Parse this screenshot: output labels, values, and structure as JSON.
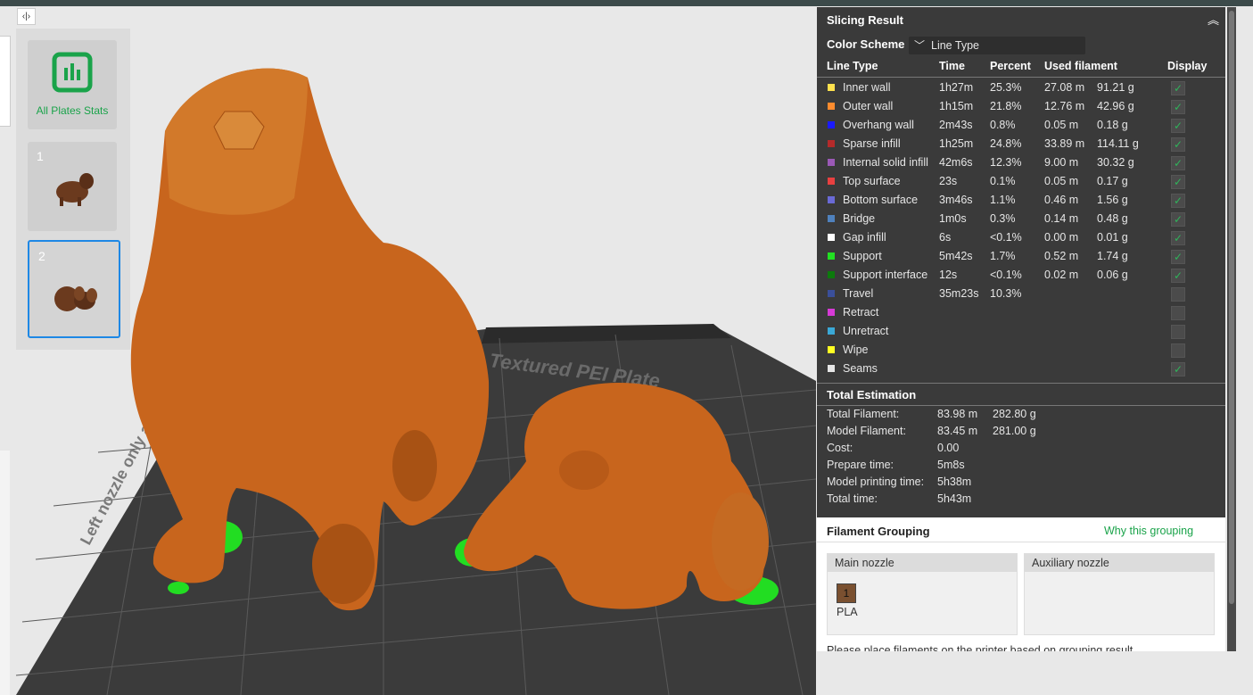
{
  "colors": {
    "accent_green": "#1aa34a",
    "panel_bg": "#3a3a3a",
    "filament_brown": "#7a5030",
    "model_orange": "#c8651d"
  },
  "sidebar": {
    "collapse_icon": "split-view-icon",
    "stats_label": "All Plates Stats",
    "plates": [
      {
        "number": "1"
      },
      {
        "number": "2",
        "selected": true
      }
    ]
  },
  "viewport": {
    "bed_label": "Textured PEI Plate",
    "bed_side_label": "Left nozzle only a"
  },
  "slicing": {
    "title": "Slicing Result",
    "color_scheme_label": "Color Scheme",
    "color_scheme_value": "Line Type",
    "columns": {
      "type": "Line Type",
      "time": "Time",
      "percent": "Percent",
      "filament": "Used filament",
      "display": "Display"
    },
    "rows": [
      {
        "name": "Inner wall",
        "color": "#ffe14d",
        "time": "1h27m",
        "percent": "25.3%",
        "meters": "27.08 m",
        "grams": "91.21 g",
        "display": true
      },
      {
        "name": "Outer wall",
        "color": "#ff8c2e",
        "time": "1h15m",
        "percent": "21.8%",
        "meters": "12.76 m",
        "grams": "42.96 g",
        "display": true
      },
      {
        "name": "Overhang wall",
        "color": "#1a1aff",
        "time": "2m43s",
        "percent": "0.8%",
        "meters": "0.05 m",
        "grams": "0.18 g",
        "display": true
      },
      {
        "name": "Sparse infill",
        "color": "#b52a2a",
        "time": "1h25m",
        "percent": "24.8%",
        "meters": "33.89 m",
        "grams": "114.11 g",
        "display": true
      },
      {
        "name": "Internal solid infill",
        "color": "#9b59b6",
        "time": "42m6s",
        "percent": "12.3%",
        "meters": "9.00 m",
        "grams": "30.32 g",
        "display": true
      },
      {
        "name": "Top surface",
        "color": "#e84040",
        "time": "23s",
        "percent": "0.1%",
        "meters": "0.05 m",
        "grams": "0.17 g",
        "display": true
      },
      {
        "name": "Bottom surface",
        "color": "#6a6ad6",
        "time": "3m46s",
        "percent": "1.1%",
        "meters": "0.46 m",
        "grams": "1.56 g",
        "display": true
      },
      {
        "name": "Bridge",
        "color": "#4f81bd",
        "time": "1m0s",
        "percent": "0.3%",
        "meters": "0.14 m",
        "grams": "0.48 g",
        "display": true
      },
      {
        "name": "Gap infill",
        "color": "#ffffff",
        "time": "6s",
        "percent": "<0.1%",
        "meters": "0.00 m",
        "grams": "0.01 g",
        "display": true
      },
      {
        "name": "Support",
        "color": "#22e022",
        "time": "5m42s",
        "percent": "1.7%",
        "meters": "0.52 m",
        "grams": "1.74 g",
        "display": true
      },
      {
        "name": "Support interface",
        "color": "#0c7a0c",
        "time": "12s",
        "percent": "<0.1%",
        "meters": "0.02 m",
        "grams": "0.06 g",
        "display": true
      },
      {
        "name": "Travel",
        "color": "#3a4f9a",
        "time": "35m23s",
        "percent": "10.3%",
        "meters": "",
        "grams": "",
        "display": false
      },
      {
        "name": "Retract",
        "color": "#d63ad6",
        "time": "",
        "percent": "",
        "meters": "",
        "grams": "",
        "display": false
      },
      {
        "name": "Unretract",
        "color": "#3aa8d6",
        "time": "",
        "percent": "",
        "meters": "",
        "grams": "",
        "display": false
      },
      {
        "name": "Wipe",
        "color": "#ffff22",
        "time": "",
        "percent": "",
        "meters": "",
        "grams": "",
        "display": false
      },
      {
        "name": "Seams",
        "color": "#e6e6e6",
        "time": "",
        "percent": "",
        "meters": "",
        "grams": "",
        "display": true
      }
    ]
  },
  "estimation": {
    "title": "Total Estimation",
    "rows": [
      {
        "label": "Total Filament:",
        "v1": "83.98 m",
        "v2": "282.80 g"
      },
      {
        "label": "Model Filament:",
        "v1": "83.45 m",
        "v2": "281.00 g"
      },
      {
        "label": "Cost:",
        "v1": "0.00",
        "v2": ""
      },
      {
        "label": "Prepare time:",
        "v1": "5m8s",
        "v2": ""
      },
      {
        "label": "Model printing time:",
        "v1": "5h38m",
        "v2": ""
      },
      {
        "label": "Total time:",
        "v1": "5h43m",
        "v2": ""
      }
    ]
  },
  "grouping": {
    "title": "Filament Grouping",
    "why_link": "Why this grouping",
    "main_nozzle": "Main nozzle",
    "aux_nozzle": "Auxiliary nozzle",
    "filament_number": "1",
    "filament_type": "PLA",
    "note": "Please place filaments on the printer based on grouping result."
  }
}
